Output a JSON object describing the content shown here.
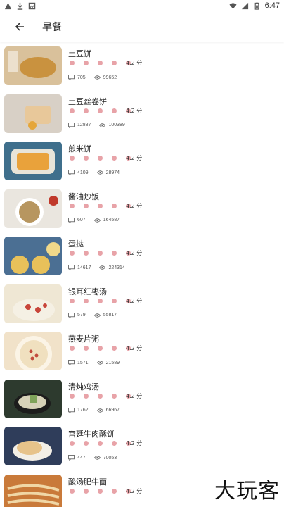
{
  "status_bar": {
    "time": "6:47"
  },
  "header": {
    "title": "早餐"
  },
  "items": [
    {
      "name": "土豆饼",
      "rating": "4.2 分",
      "comments": "705",
      "views": "99652",
      "thumb_color": "#d9c19b",
      "accent": "#c9923f"
    },
    {
      "name": "土豆丝卷饼",
      "rating": "4.2 分",
      "comments": "12887",
      "views": "100389",
      "thumb_color": "#d8d0c6",
      "accent": "#e8c89a"
    },
    {
      "name": "煎米饼",
      "rating": "4.2 分",
      "comments": "4109",
      "views": "28974",
      "thumb_color": "#3f6f8c",
      "accent": "#e9a23b"
    },
    {
      "name": "酱油炒饭",
      "rating": "4.2 分",
      "comments": "607",
      "views": "164587",
      "thumb_color": "#eae6df",
      "accent": "#b79660"
    },
    {
      "name": "蛋挞",
      "rating": "4.2 分",
      "comments": "14617",
      "views": "224314",
      "thumb_color": "#4b6f93",
      "accent": "#e8c15a"
    },
    {
      "name": "银耳红枣汤",
      "rating": "4.2 分",
      "comments": "579",
      "views": "55817",
      "thumb_color": "#efe7d4",
      "accent": "#c8453a"
    },
    {
      "name": "燕麦片粥",
      "rating": "4.2 分",
      "comments": "1571",
      "views": "21589",
      "thumb_color": "#f1e2c9",
      "accent": "#c24a3c"
    },
    {
      "name": "清炖鸡汤",
      "rating": "4.2 分",
      "comments": "1762",
      "views": "66967",
      "thumb_color": "#2d3a2e",
      "accent": "#d6d2b8"
    },
    {
      "name": "宫廷牛肉酥饼",
      "rating": "4.2 分",
      "comments": "447",
      "views": "70053",
      "thumb_color": "#2f3d5a",
      "accent": "#e7c38a"
    },
    {
      "name": "酸汤肥牛面",
      "rating": "4.2 分",
      "comments": "",
      "views": "",
      "thumb_color": "#c97a3a",
      "accent": "#f0d7a6"
    }
  ],
  "watermark": "大玩客"
}
